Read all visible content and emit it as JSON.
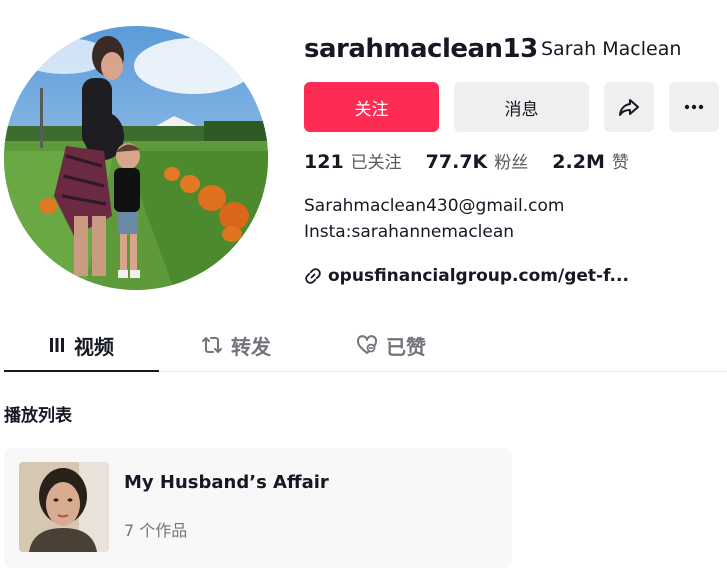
{
  "profile": {
    "username": "sarahmaclean13",
    "display_name": "Sarah Maclean",
    "follow_label": "关注",
    "message_label": "消息",
    "share_icon": "share-icon",
    "more_icon": "more-icon"
  },
  "stats": {
    "following_count": "121",
    "following_label": "已关注",
    "followers_count": "77.7K",
    "followers_label": "粉丝",
    "likes_count": "2.2M",
    "likes_label": "赞"
  },
  "bio": {
    "line1": "Sarahmaclean430@gmail.com",
    "line2": "Insta:sarahannemaclean",
    "link": "opusfinancialgroup.com/get-f..."
  },
  "tabs": [
    {
      "label": "视频",
      "icon": "grid-icon",
      "active": true
    },
    {
      "label": "转发",
      "icon": "repost-icon",
      "active": false
    },
    {
      "label": "已赞",
      "icon": "liked-heart-icon",
      "active": false
    }
  ],
  "playlists": {
    "section_title": "播放列表",
    "items": [
      {
        "name": "My Husband’s Affair",
        "count": "7 个作品"
      }
    ]
  },
  "colors": {
    "primary": "#fe2c55",
    "secondary_bg": "#efeff0",
    "text": "#161823",
    "muted": "#73747b"
  }
}
